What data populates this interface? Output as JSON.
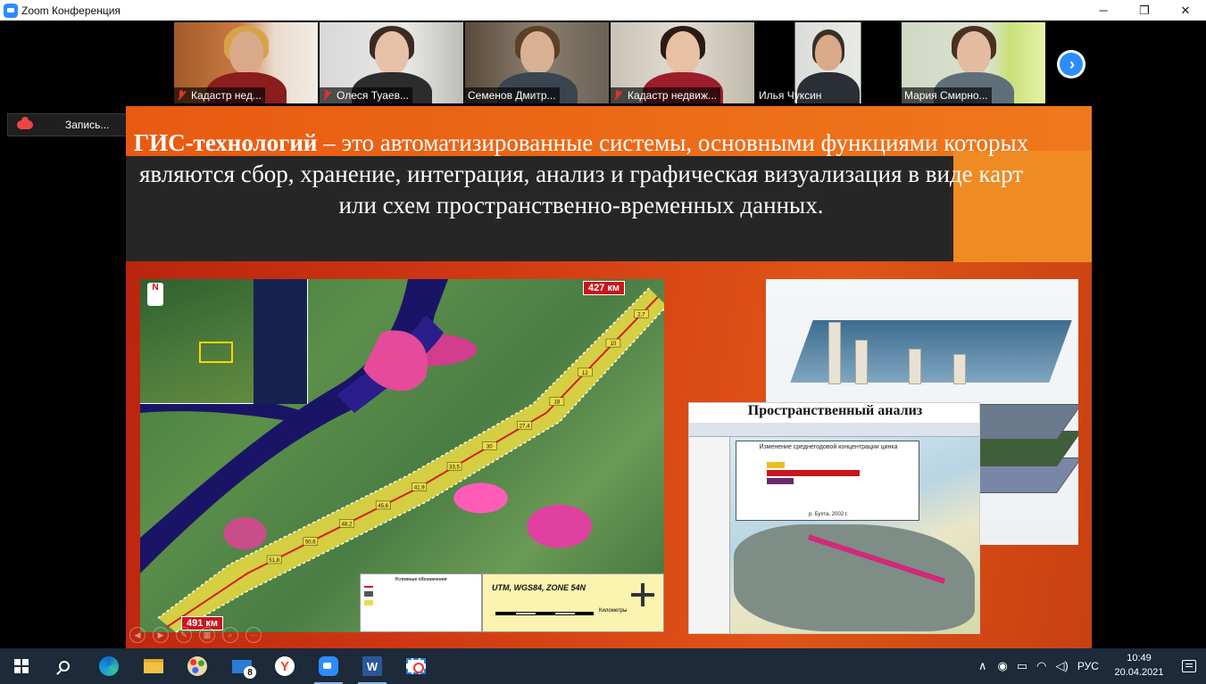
{
  "window": {
    "title": "Zoom Конференция",
    "minimize_glyph": "─",
    "maximize_glyph": "❐",
    "close_glyph": "✕"
  },
  "participants": [
    {
      "name": "Кадастр нед...",
      "muted": true
    },
    {
      "name": "Олеся Туаев...",
      "muted": true
    },
    {
      "name": "Семенов Дмитр...",
      "muted": false
    },
    {
      "name": "Кадастр недвиж...",
      "muted": true
    },
    {
      "name": "Илья Чуксин",
      "muted": false
    },
    {
      "name": "Мария Смирно...",
      "muted": false,
      "active_speaker": true
    }
  ],
  "strip_next_icon": "chevron-right-icon",
  "recording": {
    "label": "Запись..."
  },
  "slide": {
    "heading_bold": "ГИС-технологий",
    "heading_rest": " – это автоматизированные системы, основными функциями которых являются сбор, хранение, интеграция, анализ и графическая визуализация в виде карт или схем пространственно-временных данных.",
    "map": {
      "top_km": "427 км",
      "bottom_km": "491 км",
      "projection": "UTM, WGS84, ZONE 54N",
      "scale_label": "Километры",
      "north": "N",
      "legend_title": "Условные обозначения",
      "segment_labels": [
        "2,7",
        "10",
        "12",
        "18",
        "27,4",
        "30",
        "33,5",
        "41,9",
        "45,6",
        "48,2",
        "50,6",
        "51,8"
      ]
    },
    "analysis": {
      "title": "Пространственный анализ",
      "chart_title": "Изменение среднегодовой концентрации цинка",
      "chart_caption": "р. Бухта, 2002 г."
    }
  },
  "taskbar": {
    "mail_badge": "8",
    "yandex_letter": "Y",
    "word_letter": "W",
    "language": "РУС",
    "time": "10:49",
    "date": "20.04.2021"
  },
  "colors": {
    "zoom_blue": "#2d8cff",
    "slide_orange": "#e05517",
    "slide_dark": "#262626",
    "taskbar": "#1c2a3a"
  }
}
